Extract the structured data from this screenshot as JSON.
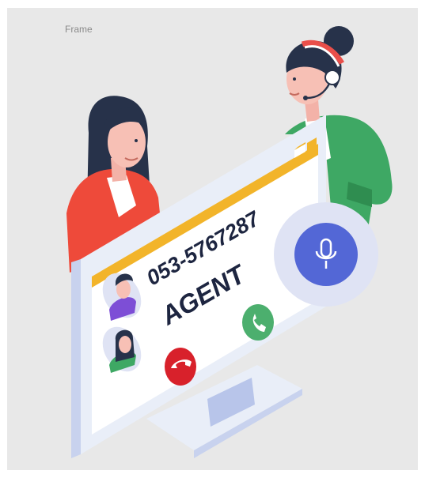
{
  "frame": {
    "label": "Frame"
  },
  "monitor": {
    "phone_number": "053-5767287",
    "role_label": "AGENT"
  },
  "colors": {
    "background": "#e8e8e8",
    "title_bar": "#f2b42a",
    "monitor_frame": "#e9eef8",
    "accept_call": "#4caf6e",
    "decline_call": "#d8212b",
    "mic_button": "#5367d6",
    "mic_halo": "#dfe3f4",
    "agent_jacket": "#3ea864",
    "caller_shirt": "#ee4a3a"
  },
  "icons": [
    "microphone-icon",
    "phone-accept-icon",
    "phone-decline-icon"
  ]
}
